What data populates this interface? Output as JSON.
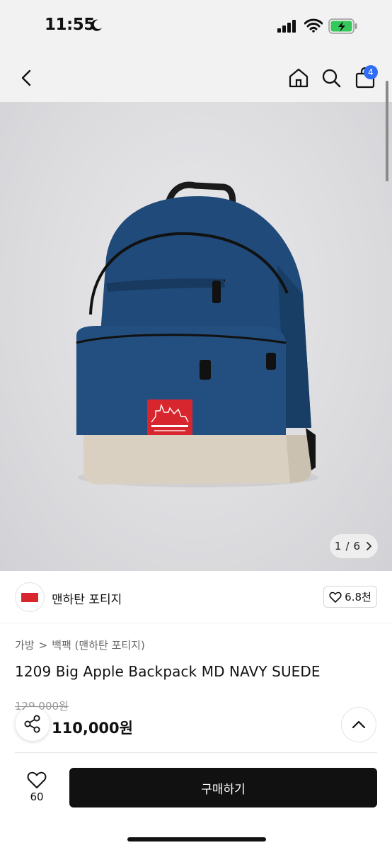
{
  "status_bar": {
    "time": "11:55",
    "icons": [
      "moon-icon",
      "cellular-signal-icon",
      "wifi-icon",
      "battery-charging-icon"
    ]
  },
  "nav": {
    "icons": [
      "back-chevron-icon",
      "home-icon",
      "search-icon",
      "shopping-bag-icon"
    ],
    "cart_count": "4"
  },
  "gallery": {
    "current": "1",
    "total": "6",
    "separator": "/",
    "next_icon": "chevron-right-icon"
  },
  "brand": {
    "name": "맨하탄 포티지",
    "likes": "6.8천",
    "accent_color": "#d8262f"
  },
  "breadcrumb": {
    "level1": "가방",
    "separator": ">",
    "level2": "백팩 (맨하탄 포티지)"
  },
  "product": {
    "title": "1209 Big Apple Backpack MD NAVY SUEDE",
    "original_price": "129,000원",
    "sale_price": "110,000원"
  },
  "bottom_bar": {
    "wish_count": "60",
    "buy_label": "구매하기"
  },
  "colors": {
    "badge_blue": "#2f6df6",
    "backpack_navy": "#1f4a79",
    "suede_beige": "#d9d0c2"
  }
}
